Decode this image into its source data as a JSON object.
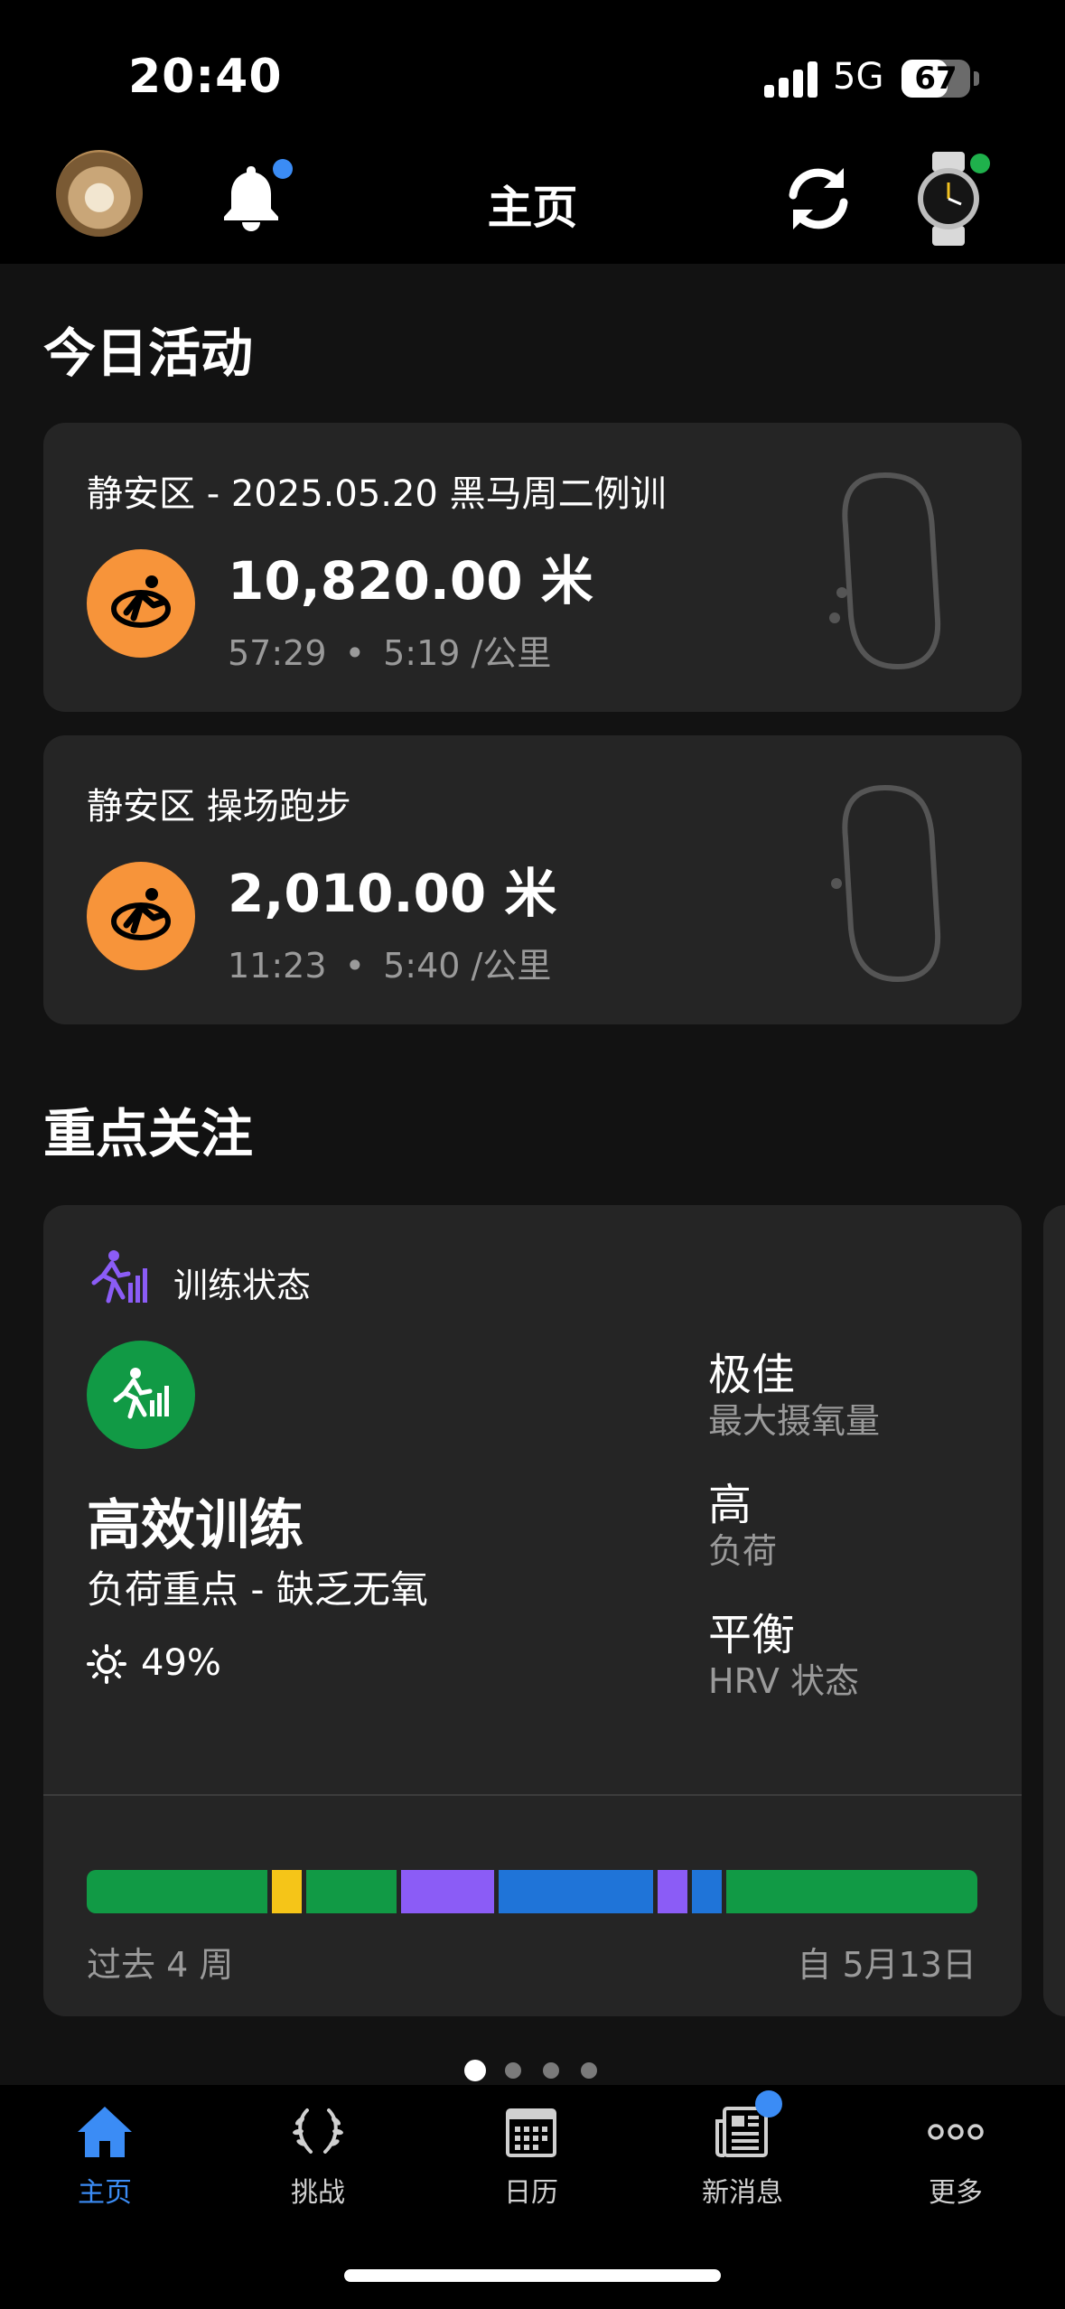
{
  "status_bar": {
    "time": "20:40",
    "network": "5G",
    "battery": "67"
  },
  "header": {
    "title": "主页",
    "notification_badge": true,
    "device_connected": true
  },
  "today": {
    "section_title": "今日活动",
    "activities": [
      {
        "title": "静安区 - 2025.05.20 黑马周二例训",
        "distance": "10,820.00 米",
        "time": "57:29",
        "pace": "5:19 /公里",
        "icon": "running-icon"
      },
      {
        "title": "静安区 操场跑步",
        "distance": "2,010.00 米",
        "time": "11:23",
        "pace": "5:40 /公里",
        "icon": "running-icon"
      }
    ]
  },
  "focus": {
    "section_title": "重点关注",
    "card": {
      "label": "训练状态",
      "status": "高效训练",
      "detail": "负荷重点 - 缺乏无氧",
      "percent": "49%",
      "metrics": [
        {
          "value": "极佳",
          "label": "最大摄氧量"
        },
        {
          "value": "高",
          "label": "负荷"
        },
        {
          "value": "平衡",
          "label": "HRV 状态"
        }
      ],
      "history_left": "过去 4 周",
      "history_right": "自 5月13日",
      "history_segments": [
        {
          "color": "#119a45",
          "weight": 20.5
        },
        {
          "color": "#f5c518",
          "weight": 3.4
        },
        {
          "color": "#119a45",
          "weight": 10.2
        },
        {
          "color": "#8b5cf6",
          "weight": 10.6
        },
        {
          "color": "#1f74d8",
          "weight": 17.5
        },
        {
          "color": "#8b5cf6",
          "weight": 3.4
        },
        {
          "color": "#1f74d8",
          "weight": 3.4
        },
        {
          "color": "#119a45",
          "weight": 28.5
        }
      ]
    },
    "pager": {
      "count": 4,
      "active": 0
    }
  },
  "tabbar": {
    "items": [
      {
        "label": "主页",
        "icon": "home-icon",
        "active": true
      },
      {
        "label": "挑战",
        "icon": "laurel-icon",
        "active": false
      },
      {
        "label": "日历",
        "icon": "calendar-icon",
        "active": false
      },
      {
        "label": "新消息",
        "icon": "news-icon",
        "active": false,
        "badge": true
      },
      {
        "label": "更多",
        "icon": "more-icon",
        "active": false
      }
    ]
  },
  "colors": {
    "accent_blue": "#3b8cf5",
    "activity_orange": "#f7943a",
    "status_green": "#119a45"
  }
}
